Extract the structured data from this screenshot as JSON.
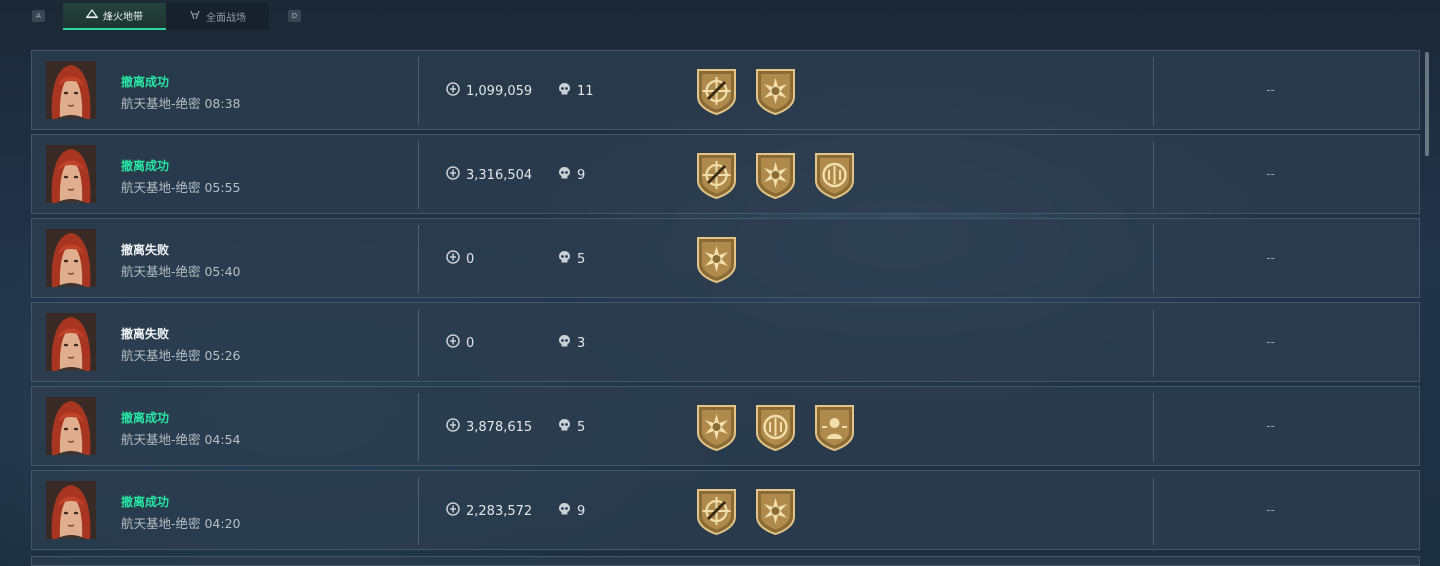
{
  "topbar": {
    "key_left": "A",
    "key_right": "D",
    "tabs": [
      {
        "label": "烽火地带",
        "active": true
      },
      {
        "label": "全面战场",
        "active": false
      }
    ]
  },
  "accent": "#27e5a2",
  "rows": [
    {
      "status": "撤离成功",
      "success": true,
      "map": "航天基地-绝密 08:38",
      "money": "1,099,059",
      "kills": "11",
      "medals": [
        "target-medal-icon",
        "sunburst-medal-icon"
      ],
      "extra": "--"
    },
    {
      "status": "撤离成功",
      "success": true,
      "map": "航天基地-绝密 05:55",
      "money": "3,316,504",
      "kills": "9",
      "medals": [
        "target-medal-icon",
        "sunburst-medal-icon",
        "laurel-medal-icon"
      ],
      "extra": "--"
    },
    {
      "status": "撤离失败",
      "success": false,
      "map": "航天基地-绝密 05:40",
      "money": "0",
      "kills": "5",
      "medals": [
        "sunburst-medal-icon"
      ],
      "extra": "--"
    },
    {
      "status": "撤离失败",
      "success": false,
      "map": "航天基地-绝密 05:26",
      "money": "0",
      "kills": "3",
      "medals": [],
      "extra": "--"
    },
    {
      "status": "撤离成功",
      "success": true,
      "map": "航天基地-绝密 04:54",
      "money": "3,878,615",
      "kills": "5",
      "medals": [
        "sunburst-medal-icon",
        "laurel-medal-icon",
        "operator-medal-icon"
      ],
      "extra": "--"
    },
    {
      "status": "撤离成功",
      "success": true,
      "map": "航天基地-绝密 04:20",
      "money": "2,283,572",
      "kills": "9",
      "medals": [
        "target-medal-icon",
        "sunburst-medal-icon"
      ],
      "extra": "--"
    }
  ]
}
